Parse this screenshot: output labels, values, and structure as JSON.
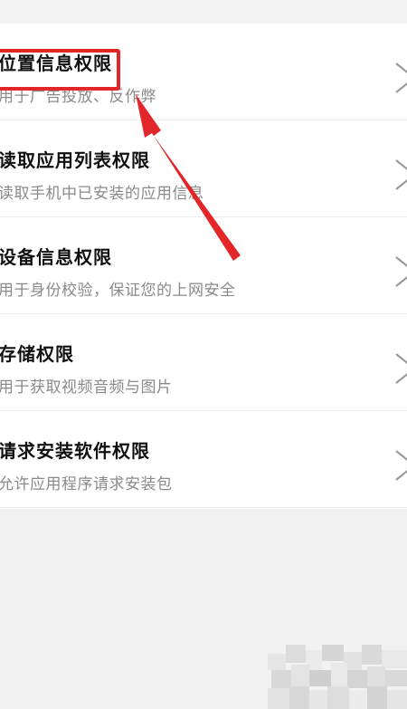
{
  "permissions": [
    {
      "title": "位置信息权限",
      "desc": "用于广告投放、反作弊"
    },
    {
      "title": "读取应用列表权限",
      "desc": "读取手机中已安装的应用信息"
    },
    {
      "title": "设备信息权限",
      "desc": "用于身份校验，保证您的上网安全"
    },
    {
      "title": "存储权限",
      "desc": "用于获取视频音频与图片"
    },
    {
      "title": "请求安装软件权限",
      "desc": "允许应用程序请求安装包"
    }
  ],
  "annotation_color": "#e2262a",
  "chevron_icon": "chevron-right-icon"
}
